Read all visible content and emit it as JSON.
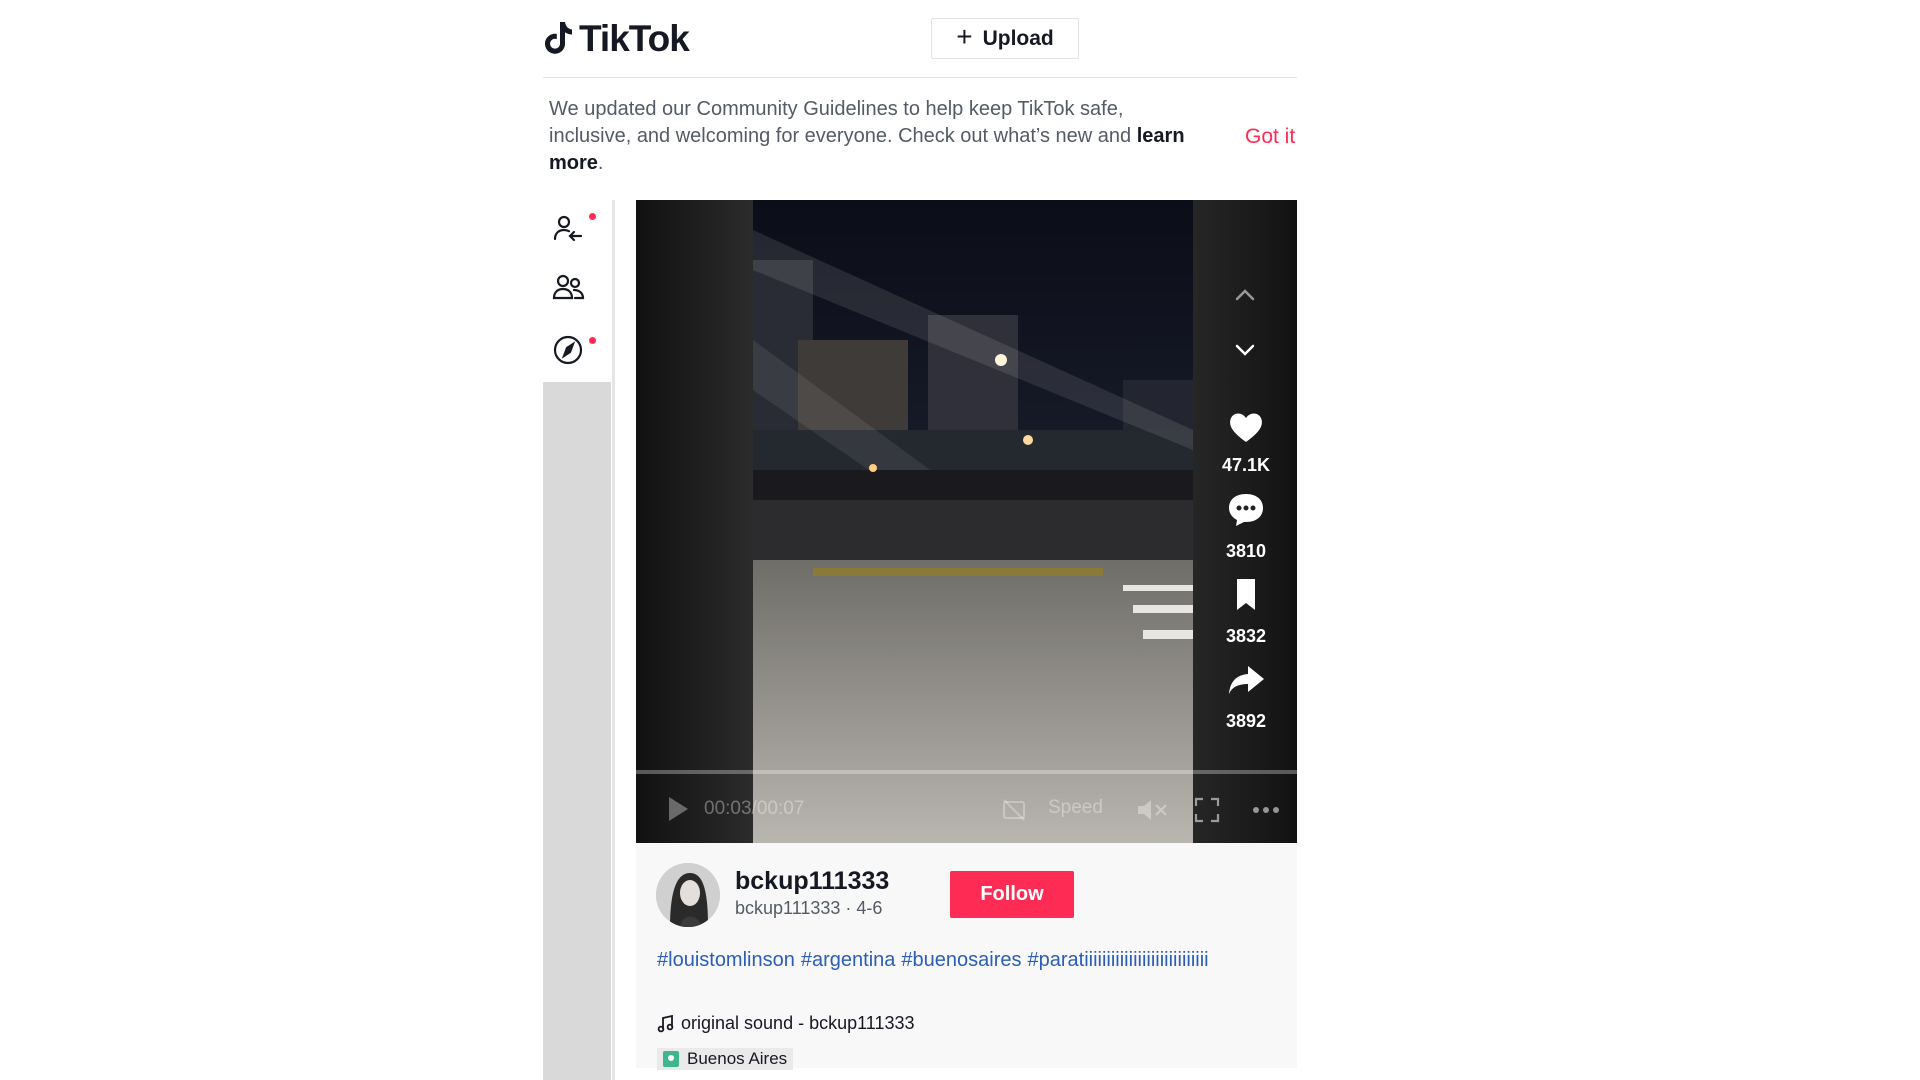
{
  "header": {
    "logo_text": "TikTok",
    "upload_label": "Upload"
  },
  "banner": {
    "text_1": "We updated our Community Guidelines to help keep TikTok safe, inclusive, and welcoming for everyone. Check out what’s new and ",
    "link": "learn more",
    "text_2": ".",
    "dismiss": "Got it"
  },
  "sidebar": {
    "icons": [
      "follow-user-icon",
      "friends-icon",
      "explore-compass-icon"
    ]
  },
  "video": {
    "time": "00:03/00:07",
    "speed_label": "Speed",
    "likes": "47.1K",
    "comments": "3810",
    "saves": "3832",
    "shares": "3892"
  },
  "post": {
    "username": "bckup111333",
    "handle_date": "bckup111333 · 4-6",
    "follow_label": "Follow",
    "hashtags": [
      "#louistomlinson",
      "#argentina",
      "#buenosaires",
      "#paratiiiiiiiiiiiiiiiiiiiiiiiiiiii"
    ],
    "sound": "original sound - bckup111333",
    "location": "Buenos Aires"
  },
  "colors": {
    "accent": "#fe2c55",
    "hashtag": "#2b5db9"
  }
}
